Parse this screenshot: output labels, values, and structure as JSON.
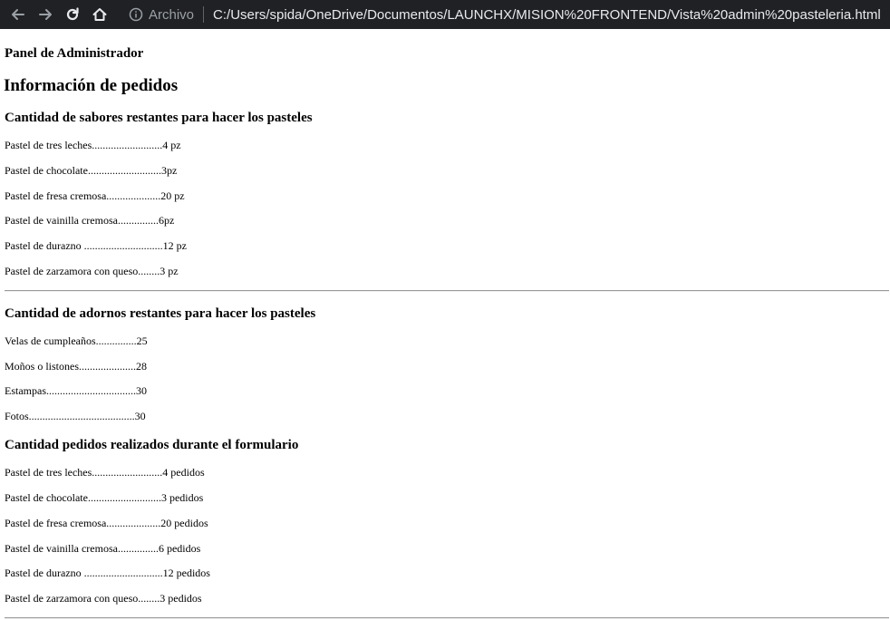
{
  "browser": {
    "scheme": "Archivo",
    "url": "C:/Users/spida/OneDrive/Documentos/LAUNCHX/MISION%20FRONTEND/Vista%20admin%20pasteleria.html"
  },
  "page": {
    "panel_title": "Panel de Administrador",
    "info_title": "Información de pedidos",
    "sabores": {
      "title": "Cantidad de sabores restantes para hacer los pasteles",
      "items": [
        "Pastel de tres leches..........................4 pz",
        "Pastel de chocolate...........................3pz",
        "Pastel de fresa cremosa....................20 pz",
        "Pastel de vainilla cremosa...............6pz",
        "Pastel de durazno .............................12 pz",
        "Pastel de zarzamora con queso........3 pz"
      ]
    },
    "adornos": {
      "title": "Cantidad de adornos restantes para hacer los pasteles",
      "items": [
        "Velas de cumpleaños...............25",
        "Moños o listones.....................28",
        "Estampas.................................30",
        "Fotos.......................................30"
      ]
    },
    "pedidos": {
      "title": "Cantidad pedidos realizados durante el formulario",
      "items": [
        "Pastel de tres leches..........................4 pedidos",
        "Pastel de chocolate...........................3 pedidos",
        "Pastel de fresa cremosa....................20 pedidos",
        "Pastel de vainilla cremosa...............6 pedidos",
        "Pastel de durazno .............................12 pedidos",
        "Pastel de zarzamora con queso........3 pedidos"
      ]
    }
  }
}
